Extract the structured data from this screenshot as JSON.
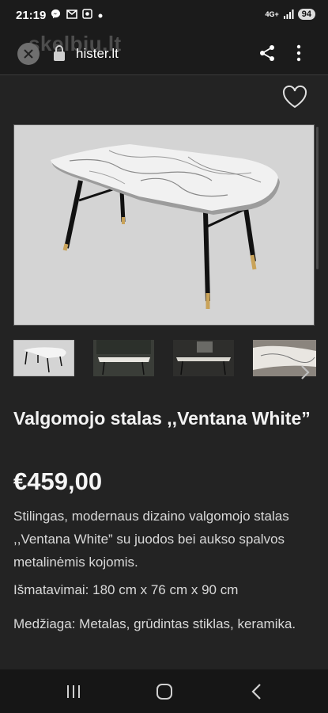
{
  "status_bar": {
    "time": "21:19",
    "notification_icons": [
      "messenger-icon",
      "gmail-icon",
      "screenshot-icon",
      "dot-icon"
    ],
    "network": "4G+",
    "battery": "94"
  },
  "browser": {
    "watermark": "skelbiu.lt",
    "url": "hister.lt",
    "close_icon": "close-icon",
    "lock_icon": "lock-icon",
    "share_icon": "share-icon",
    "menu_icon": "more-vert-icon"
  },
  "product": {
    "title": "Valgomojo stalas ,,Ventana White”",
    "price": "€459,00",
    "description": "Stilingas, modernaus dizaino valgomojo stalas ,,Ventana White” su juodos bei aukso spalvos metalinėmis kojomis.",
    "dimensions": "Išmatavimai: 180 cm x 76 cm x 90 cm",
    "material": "Medžiaga: Metalas, grūdintas stiklas, keramika."
  },
  "gallery": {
    "thumbnail_count": 4,
    "selected_index": 0
  },
  "colors": {
    "background": "#232323",
    "text": "#e8e8e8"
  }
}
